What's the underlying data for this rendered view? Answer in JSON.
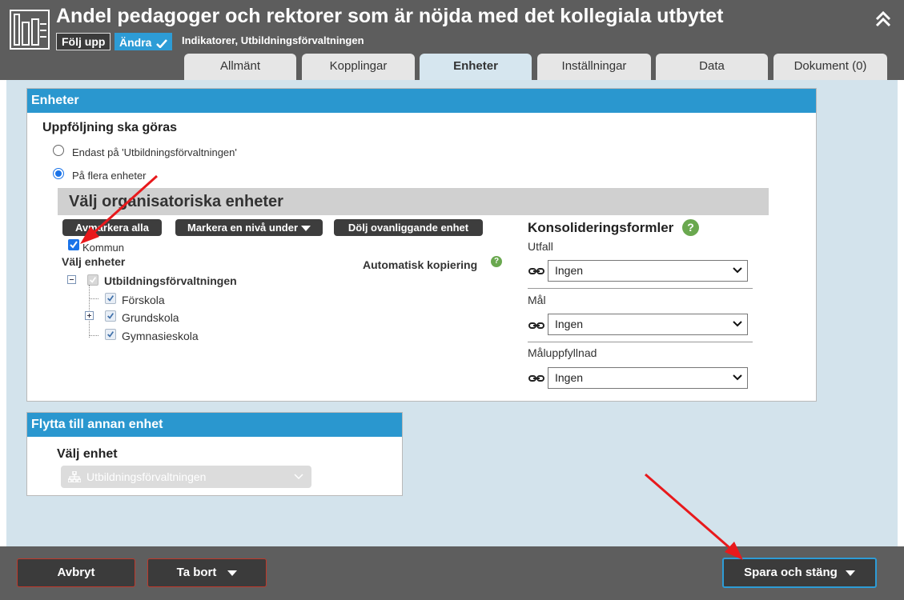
{
  "header": {
    "title": "Andel pedagoger och rektorer som är nöjda med det kollegiala utbytet",
    "follow_label": "Följ upp",
    "change_label": "Ändra",
    "subtitle": "Indikatorer, Utbildningsförvaltningen"
  },
  "tabs": [
    {
      "label": "Allmänt",
      "active": false
    },
    {
      "label": "Kopplingar",
      "active": false
    },
    {
      "label": "Enheter",
      "active": true
    },
    {
      "label": "Inställningar",
      "active": false
    },
    {
      "label": "Data",
      "active": false
    },
    {
      "label": "Dokument (0)",
      "active": false
    }
  ],
  "enheter_panel": {
    "header": "Enheter",
    "followup_title": "Uppföljning ska göras",
    "option_only": "Endast på 'Utbildningsförvaltningen'",
    "option_multiple": "På flera enheter",
    "org_title": "Välj organisatoriska enheter",
    "btn_unmark": "Avmarkera alla",
    "btn_level": "Markera en nivå under",
    "btn_hide": "Dölj ovanliggande enhet",
    "kommun_label": "Kommun",
    "select_units_label": "Välj enheter",
    "auto_copy_label": "Automatisk kopiering",
    "tree": {
      "root": "Utbildningsförvaltningen",
      "children": [
        "Förskola",
        "Grundskola",
        "Gymnasieskola"
      ]
    },
    "consolidation": {
      "title": "Konsolideringsformler",
      "fields": [
        {
          "label": "Utfall",
          "value": "Ingen"
        },
        {
          "label": "Mål",
          "value": "Ingen"
        },
        {
          "label": "Måluppfyllnad",
          "value": "Ingen"
        }
      ]
    }
  },
  "move_panel": {
    "header": "Flytta till annan enhet",
    "select_label": "Välj enhet",
    "select_value": "Utbildningsförvaltningen"
  },
  "footer": {
    "cancel": "Avbryt",
    "delete": "Ta bort",
    "save_close": "Spara och stäng"
  },
  "colors": {
    "accent": "#2a97cf",
    "header_bg": "#5d5d5d",
    "annotation_arrow": "#e8191c"
  }
}
